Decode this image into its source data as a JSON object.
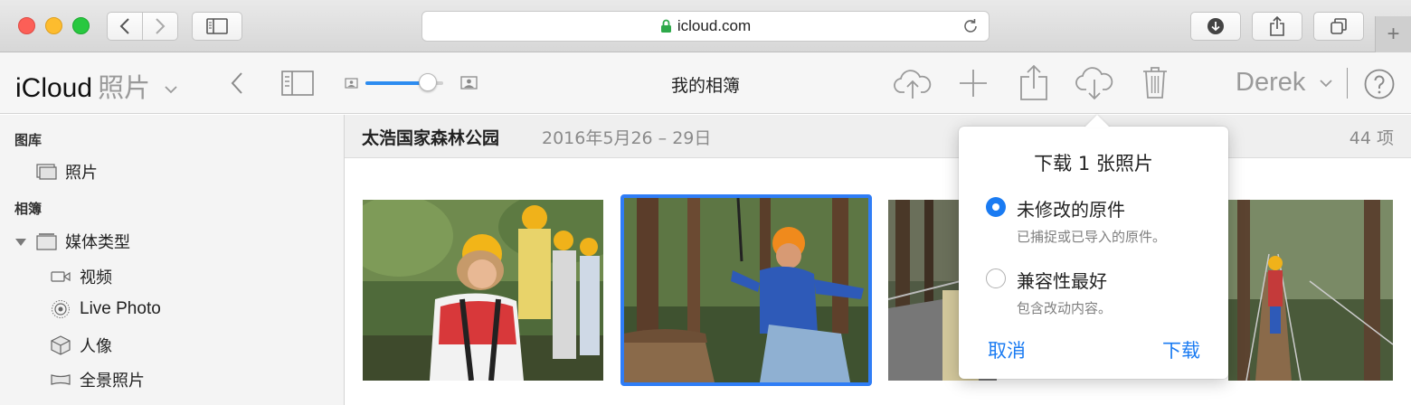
{
  "browser": {
    "url": "icloud.com"
  },
  "toolbar": {
    "brand": "iCloud",
    "app_name": "照片",
    "title": "我的相簿",
    "user": "Derek",
    "zoom_level": 0.8
  },
  "sidebar": {
    "library_heading": "图库",
    "library_items": [
      {
        "label": "照片",
        "icon": "photos-stack-icon"
      }
    ],
    "albums_heading": "相簿",
    "media_types": {
      "label": "媒体类型",
      "icon": "album-stack-icon",
      "expanded": true
    },
    "media_items": [
      {
        "label": "视频",
        "icon": "video-camera-icon"
      },
      {
        "label": "Live Photo",
        "icon": "live-photo-icon"
      },
      {
        "label": "人像",
        "icon": "cube-icon"
      },
      {
        "label": "全景照片",
        "icon": "panorama-icon"
      }
    ]
  },
  "album": {
    "name": "太浩国家森林公园",
    "date_range": "2016年5月26 – 29日",
    "count": "44 项"
  },
  "photos": [
    {
      "description": "kids in helmets at zipline course",
      "selected": false
    },
    {
      "description": "girl on zipline platform in forest",
      "selected": true
    },
    {
      "description": "child on rope bridge",
      "selected": false
    },
    {
      "description": "suspension bridge in trees",
      "selected": false
    }
  ],
  "download_popover": {
    "title": "下载 1 张照片",
    "options": [
      {
        "label": "未修改的原件",
        "description": "已捕捉或已导入的原件。",
        "selected": true
      },
      {
        "label": "兼容性最好",
        "description": "包含改动内容。",
        "selected": false
      }
    ],
    "cancel_label": "取消",
    "download_label": "下载"
  },
  "colors": {
    "accent": "#1a7bf2",
    "selection": "#2f7df6"
  }
}
